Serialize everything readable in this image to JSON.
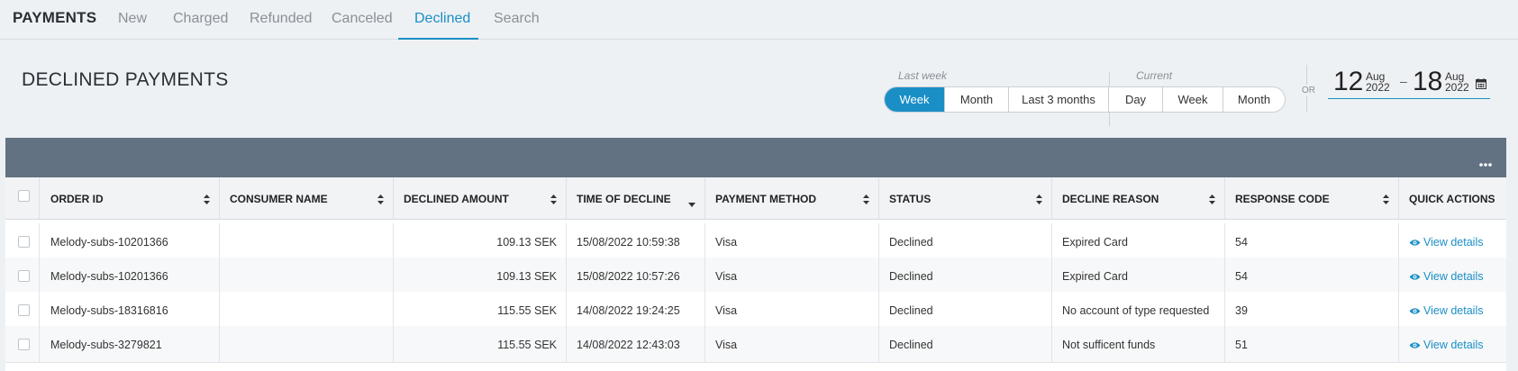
{
  "nav": {
    "brand": "PAYMENTS",
    "tabs": [
      {
        "label": "New"
      },
      {
        "label": "Charged"
      },
      {
        "label": "Refunded"
      },
      {
        "label": "Canceled"
      },
      {
        "label": "Declined",
        "active": true
      },
      {
        "label": "Search"
      }
    ]
  },
  "page": {
    "title": "DECLINED PAYMENTS"
  },
  "period": {
    "last_week_caption": "Last week",
    "current_caption": "Current",
    "last_buttons": [
      "Week",
      "Month",
      "Last 3 months"
    ],
    "current_buttons": [
      "Day",
      "Week",
      "Month"
    ],
    "active": "Week",
    "or_label": "OR"
  },
  "daterange": {
    "from_day": "12",
    "from_month": "Aug",
    "from_year": "2022",
    "separator": "–",
    "to_day": "18",
    "to_month": "Aug",
    "to_year": "2022"
  },
  "table": {
    "more_icon": "ellipsis-icon",
    "columns": [
      "ORDER ID",
      "CONSUMER NAME",
      "DECLINED AMOUNT",
      "TIME OF DECLINE",
      "PAYMENT METHOD",
      "STATUS",
      "DECLINE REASON",
      "RESPONSE CODE",
      "QUICK ACTIONS"
    ],
    "rows": [
      {
        "order_id": "Melody-subs-10201366",
        "consumer": "",
        "amount": "109.13 SEK",
        "time": "15/08/2022 10:59:38",
        "method": "Visa",
        "status": "Declined",
        "reason": "Expired Card",
        "code": "54",
        "action": "View details"
      },
      {
        "order_id": "Melody-subs-10201366",
        "consumer": "",
        "amount": "109.13 SEK",
        "time": "15/08/2022 10:57:26",
        "method": "Visa",
        "status": "Declined",
        "reason": "Expired Card",
        "code": "54",
        "action": "View details"
      },
      {
        "order_id": "Melody-subs-18316816",
        "consumer": "",
        "amount": "115.55 SEK",
        "time": "14/08/2022 19:24:25",
        "method": "Visa",
        "status": "Declined",
        "reason": "No account of type requested",
        "code": "39",
        "action": "View details"
      },
      {
        "order_id": "Melody-subs-3279821",
        "consumer": "",
        "amount": "115.55 SEK",
        "time": "14/08/2022 12:43:03",
        "method": "Visa",
        "status": "Declined",
        "reason": "Not sufficent funds",
        "code": "51",
        "action": "View details"
      }
    ]
  },
  "colors": {
    "accent": "#1a8fc6",
    "panel_header": "#627282",
    "background": "#eef1f4"
  }
}
